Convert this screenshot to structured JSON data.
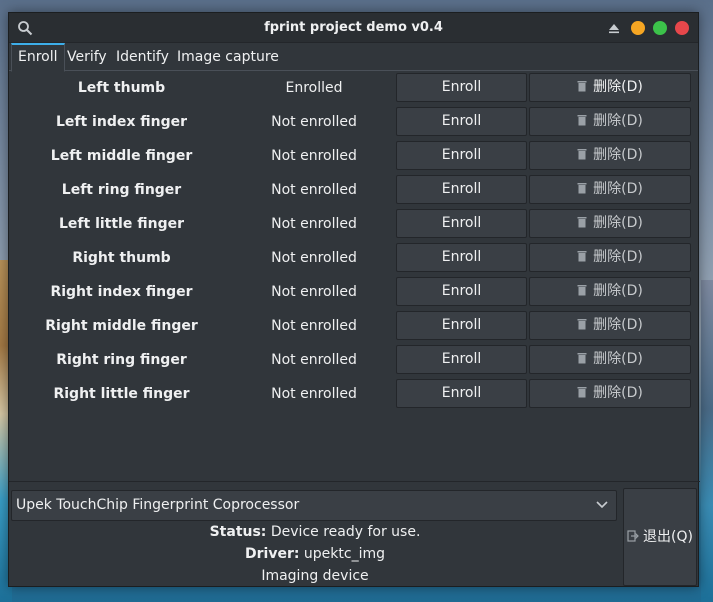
{
  "window": {
    "title": "fprint project demo v0.4"
  },
  "tabs": [
    {
      "label": "Enroll",
      "active": true
    },
    {
      "label": "Verify",
      "active": false
    },
    {
      "label": "Identify",
      "active": false
    },
    {
      "label": "Image capture",
      "active": false
    }
  ],
  "fingers": [
    {
      "name": "Left thumb",
      "status": "Enrolled",
      "enroll_label": "Enroll",
      "delete_label": "删除(D)",
      "delete_enabled": true
    },
    {
      "name": "Left index finger",
      "status": "Not enrolled",
      "enroll_label": "Enroll",
      "delete_label": "删除(D)",
      "delete_enabled": false
    },
    {
      "name": "Left middle finger",
      "status": "Not enrolled",
      "enroll_label": "Enroll",
      "delete_label": "删除(D)",
      "delete_enabled": false
    },
    {
      "name": "Left ring finger",
      "status": "Not enrolled",
      "enroll_label": "Enroll",
      "delete_label": "删除(D)",
      "delete_enabled": false
    },
    {
      "name": "Left little finger",
      "status": "Not enrolled",
      "enroll_label": "Enroll",
      "delete_label": "删除(D)",
      "delete_enabled": false
    },
    {
      "name": "Right thumb",
      "status": "Not enrolled",
      "enroll_label": "Enroll",
      "delete_label": "删除(D)",
      "delete_enabled": false
    },
    {
      "name": "Right index finger",
      "status": "Not enrolled",
      "enroll_label": "Enroll",
      "delete_label": "删除(D)",
      "delete_enabled": false
    },
    {
      "name": "Right middle finger",
      "status": "Not enrolled",
      "enroll_label": "Enroll",
      "delete_label": "删除(D)",
      "delete_enabled": false
    },
    {
      "name": "Right ring finger",
      "status": "Not enrolled",
      "enroll_label": "Enroll",
      "delete_label": "删除(D)",
      "delete_enabled": false
    },
    {
      "name": "Right little finger",
      "status": "Not enrolled",
      "enroll_label": "Enroll",
      "delete_label": "删除(D)",
      "delete_enabled": false
    }
  ],
  "device": {
    "selected": "Upek TouchChip Fingerprint Coprocessor",
    "status_label": "Status:",
    "status_value": "Device ready for use.",
    "driver_label": "Driver:",
    "driver_value": "upektc_img",
    "type": "Imaging device"
  },
  "quit_label": "退出(Q)",
  "colors": {
    "window_bg": "#31363b",
    "button_bg": "#3a3f45",
    "accent": "#3daee9",
    "minimize": "#f6a623",
    "maximize": "#3cc24a",
    "close": "#e6474b"
  },
  "icons": {
    "titlebar_left": "search-icon",
    "keep_above": "keep-above-icon",
    "delete": "trash-icon",
    "combo": "chevron-down-icon",
    "quit": "exit-icon"
  }
}
